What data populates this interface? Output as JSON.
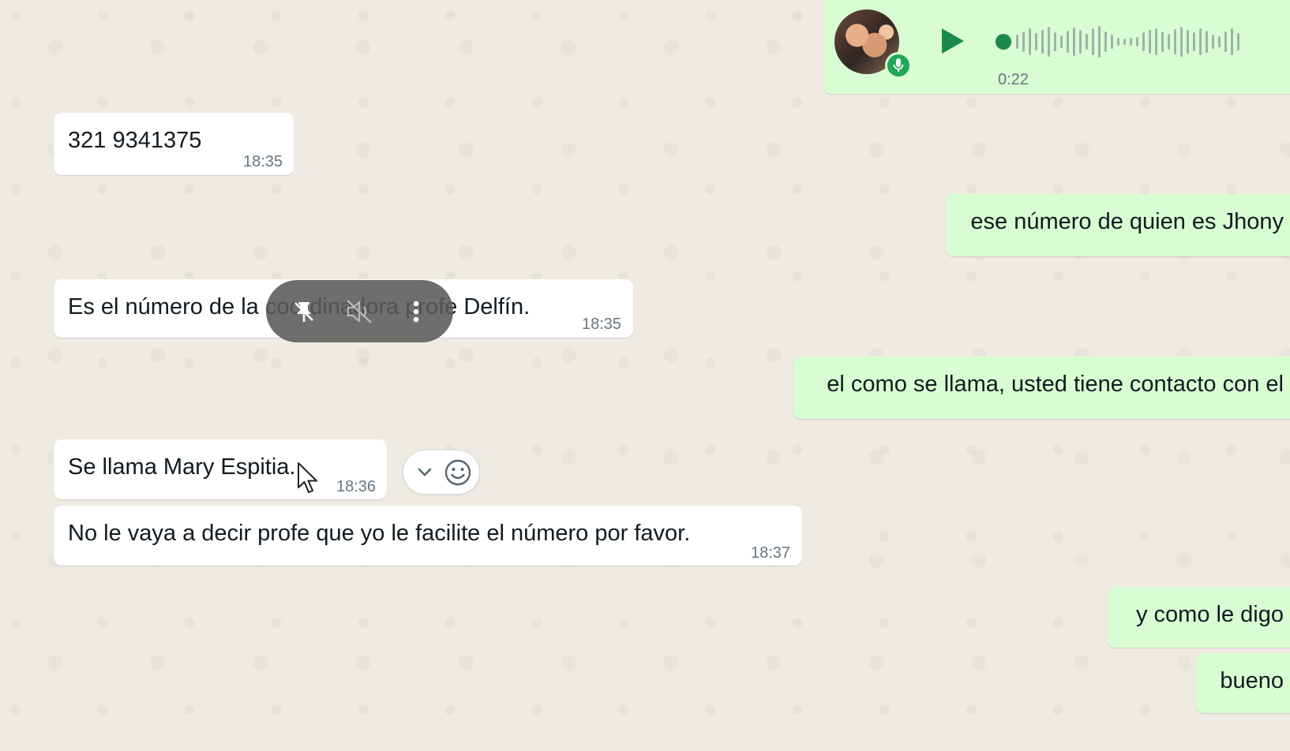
{
  "voice_note": {
    "duration": "0:22",
    "progress": 0
  },
  "messages": [
    {
      "direction": "in",
      "text": "321 9341375",
      "time": "18:35"
    },
    {
      "direction": "out",
      "text": "ese número de quien es Jhony"
    },
    {
      "direction": "in",
      "text": "Es el número de la coordinadora profe Delfín.",
      "time": "18:35"
    },
    {
      "direction": "out",
      "text": "el como se llama, usted tiene contacto con el"
    },
    {
      "direction": "in",
      "text": "Se llama Mary Espitia.",
      "time": "18:36"
    },
    {
      "direction": "in",
      "text": "No le vaya a decir profe que yo le facilite el número por favor.",
      "time": "18:37"
    },
    {
      "direction": "out",
      "text": "y como le digo"
    },
    {
      "direction": "out",
      "text": "bueno"
    }
  ],
  "overlay": {
    "icons": [
      "unpin-icon",
      "mute-icon",
      "more-vertical-icon"
    ]
  },
  "hover_actions": {
    "icons": [
      "chevron-down-icon",
      "emoji-icon"
    ]
  },
  "colors": {
    "incoming": "#ffffff",
    "outgoing": "#d9fdd3",
    "accent": "#1b8a4a",
    "chat_bg": "#efeae2"
  }
}
